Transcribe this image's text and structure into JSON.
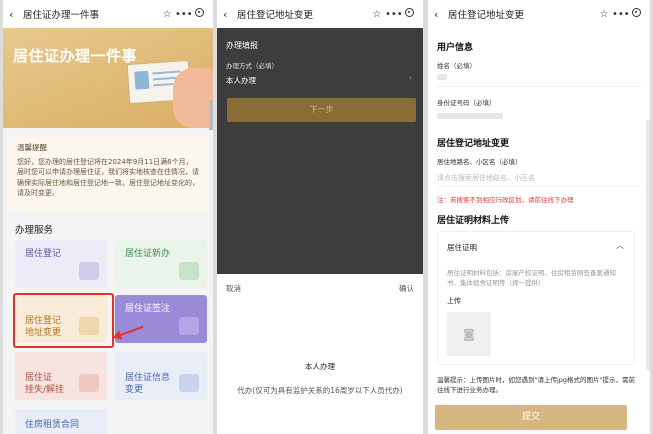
{
  "panel1": {
    "title": "居住证办理一件事",
    "banner_title": "居住证办理一件事",
    "notice_title": "温馨提醒",
    "notice_text": "您好，您办理的居住登记将在2024年9月11日满6个月，届时您可以申请办理居住证，我们将实地核查在住情况，请确保实际居住地和居住登记地一致。居住登记地址变化的，请及时变更。",
    "section": "办理服务",
    "tiles": [
      {
        "label": "居住登记"
      },
      {
        "label": "居住证新办"
      },
      {
        "label": "居住登记\n地址变更"
      },
      {
        "label": "居住证签注"
      },
      {
        "label": "居住证\n挂失/解挂"
      },
      {
        "label": "居住证信息\n变更"
      },
      {
        "label": "住房租赁合同"
      }
    ]
  },
  "panel2": {
    "title": "居住登记地址变更",
    "form_title": "办理填报",
    "field_label": "办理方式（必填）",
    "field_value": "本人办理",
    "next": "下一步",
    "cancel": "取消",
    "confirm": "确认",
    "options": [
      "本人办理",
      "代办(仅可为具有监护关系的16周岁以下人员代办)"
    ]
  },
  "panel3": {
    "title": "居住登记地址变更",
    "user_title": "用户信息",
    "name_label": "姓名（必填）",
    "id_label": "身份证号码（必填）",
    "addr_title": "居住登记地址变更",
    "addr_label": "居住地路名、小区名（必填）",
    "addr_placeholder": "请点击搜索居住地路名、小区名",
    "warning": "注：若搜索不到相应行政区划，请前往线下办理",
    "material_title": "居住证明材料上传",
    "box_title": "居住证明",
    "box_desc": "居住证明材料包括：房屋产权证明、住房租赁网签备案通知书、集体宿舍证明等（择一提供）",
    "upload": "上传",
    "tip": "温馨提示：上传图片时，如您遇到\"请上传jpg格式的图片\"提示，需前往线下进行业务办理。",
    "submit": "提交"
  }
}
